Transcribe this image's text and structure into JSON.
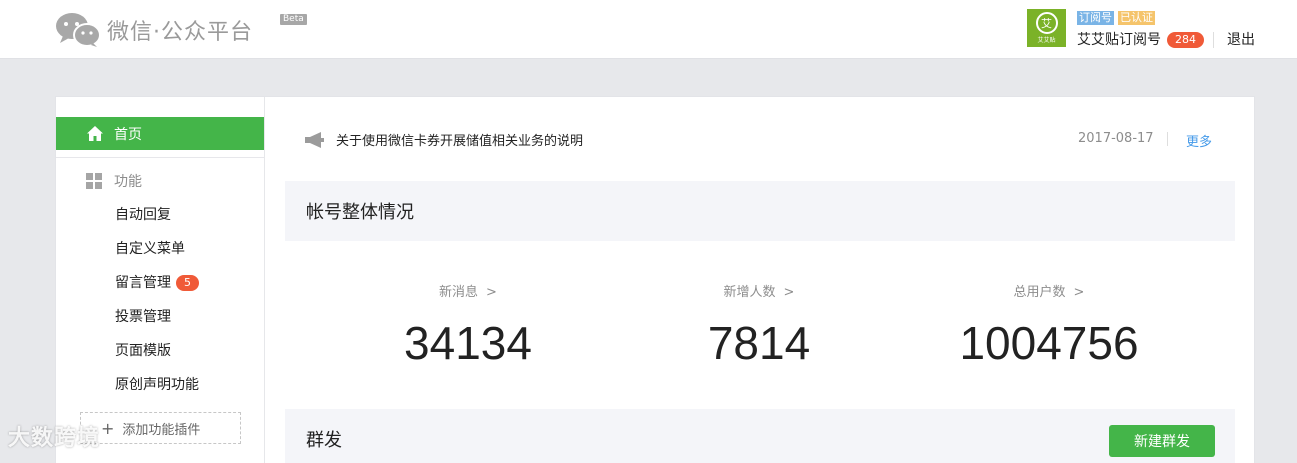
{
  "header": {
    "logo_text": "微信·公众平台",
    "beta_label": "Beta",
    "avatar_text": "艾",
    "avatar_caption": "艾艾贴",
    "tag_subscribe": "订阅号",
    "tag_verified": "已认证",
    "account_name": "艾艾贴订阅号",
    "message_count": "284",
    "logout_label": "退出"
  },
  "sidebar": {
    "home_label": "首页",
    "function_label": "功能",
    "items": [
      {
        "label": "自动回复"
      },
      {
        "label": "自定义菜单"
      },
      {
        "label": "留言管理",
        "badge": "5"
      },
      {
        "label": "投票管理"
      },
      {
        "label": "页面模版"
      },
      {
        "label": "原创声明功能"
      }
    ],
    "add_plugin_label": "添加功能插件"
  },
  "notice": {
    "text": "关于使用微信卡券开展储值相关业务的说明",
    "date": "2017-08-17",
    "more_label": "更多"
  },
  "overview": {
    "title": "帐号整体情况",
    "stats": [
      {
        "label": "新消息",
        "value": "34134"
      },
      {
        "label": "新增人数",
        "value": "7814"
      },
      {
        "label": "总用户数",
        "value": "1004756"
      }
    ]
  },
  "mass_send": {
    "title": "群发",
    "button_label": "新建群发"
  },
  "watermark": "大数跨境",
  "colors": {
    "accent_green": "#44b549",
    "badge_red": "#f05a38",
    "link_blue": "#459ae9",
    "tag_blue": "#7ab4e6",
    "tag_orange": "#f5c46b"
  }
}
